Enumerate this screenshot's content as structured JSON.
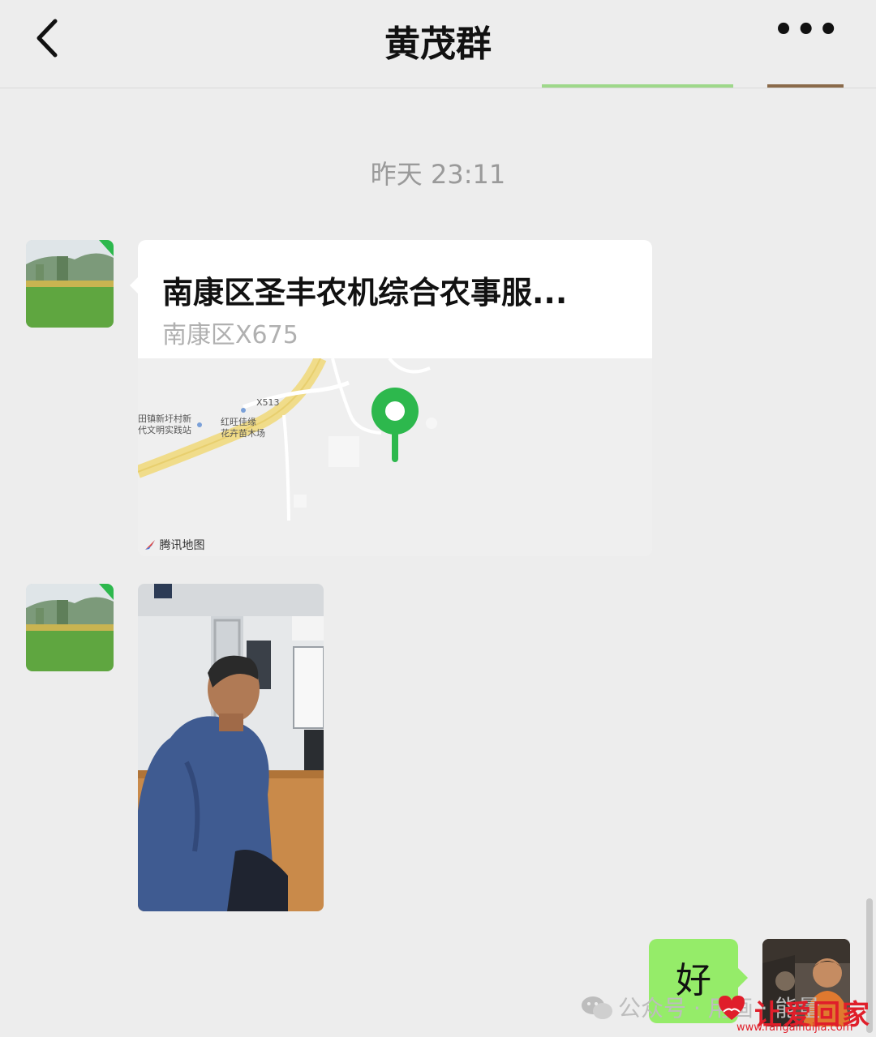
{
  "header": {
    "title": "黄茂群",
    "back_icon": "chevron-left-icon",
    "more_label": "•••"
  },
  "timestamp": "昨天 23:11",
  "location_message": {
    "title": "南康区圣丰农机综合农事服...",
    "address": "南康区X675",
    "map": {
      "road_label": "X513",
      "poi_1_line1": "田镇新圩村新",
      "poi_1_line2": "代文明实践站",
      "poi_2_line1": "红旺佳缘",
      "poi_2_line2": "花卉苗木场",
      "attribution": "腾讯地图",
      "pin_color": "#2db84d"
    }
  },
  "outgoing_message": {
    "text": "好",
    "bubble_color": "#95ec69"
  },
  "watermark": {
    "text": "公众号 · 用画 ·     能量",
    "logo_text": "让爱回家",
    "url": "www.rangaihuijia.com"
  },
  "colors": {
    "background": "#ededed",
    "accent_green": "#2db84d",
    "logo_red": "#e01e2a"
  }
}
